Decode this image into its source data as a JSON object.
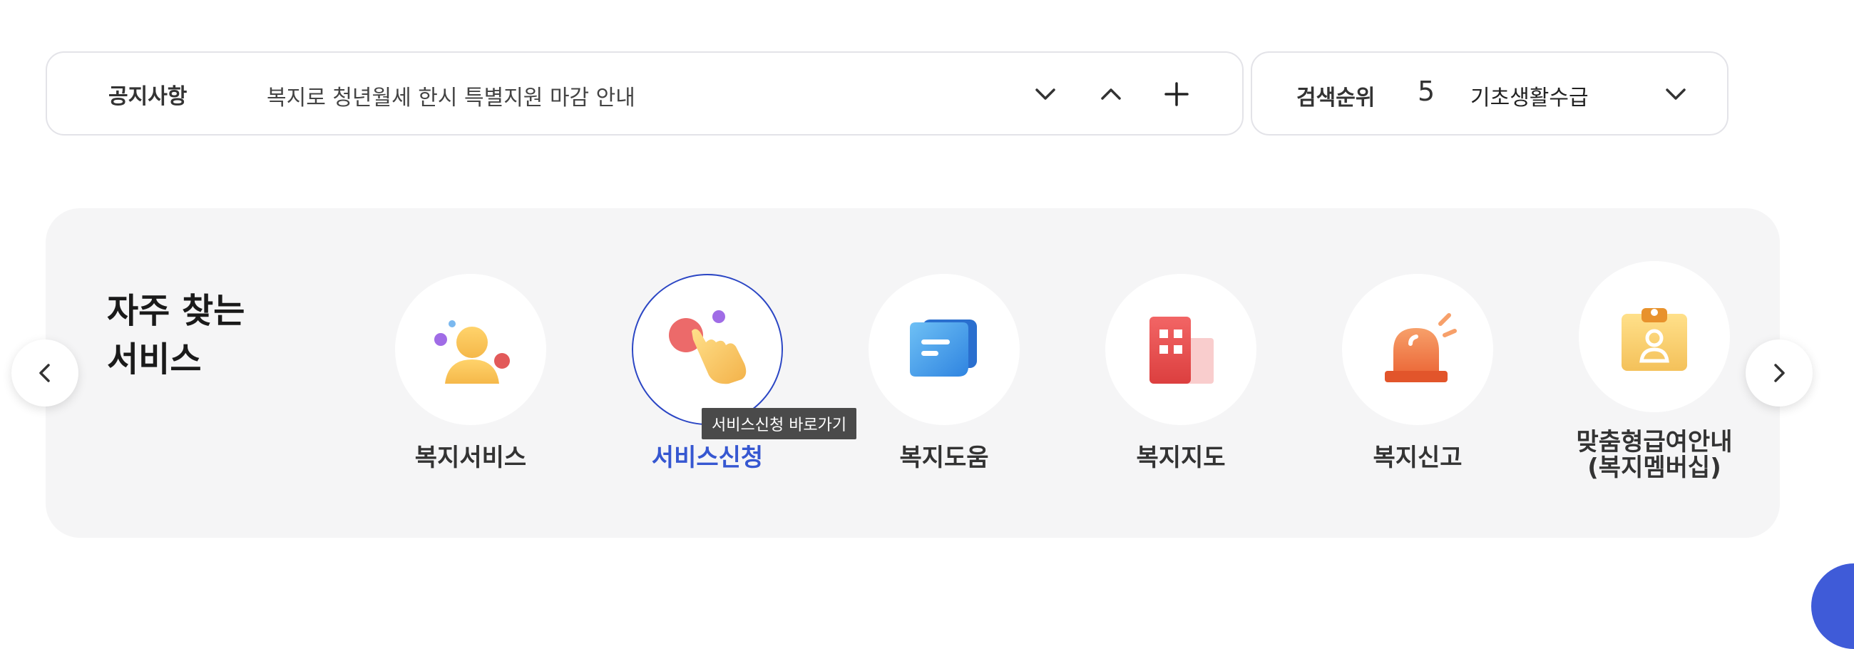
{
  "notice": {
    "label": "공지사항",
    "text": "복지로 청년월세 한시 특별지원 마감 안내",
    "next_icon": "chevron-down-icon",
    "prev_icon": "chevron-up-icon",
    "more_icon": "plus-icon"
  },
  "search_rank": {
    "label": "검색순위",
    "number": "5",
    "term": "기초생활수급",
    "toggle_icon": "chevron-down-icon"
  },
  "frequent_services": {
    "title_line1": "자주 찾는",
    "title_line2": "서비스",
    "items": [
      {
        "label": "복지서비스",
        "icon": "person-icon"
      },
      {
        "label": "서비스신청",
        "icon": "tap-hand-icon",
        "active": true
      },
      {
        "label": "복지도움",
        "icon": "chat-bubble-icon"
      },
      {
        "label": "복지지도",
        "icon": "building-icon"
      },
      {
        "label": "복지신고",
        "icon": "alarm-siren-icon"
      },
      {
        "label_line1": "맞춤형급여안내",
        "label_line2": "(복지멤버십)",
        "icon": "id-badge-icon"
      }
    ],
    "tooltip": "서비스신청 바로가기",
    "prev_icon": "chevron-left-icon",
    "next_icon": "chevron-right-icon"
  },
  "colors": {
    "accent": "#3657d1",
    "panel_bg": "#f5f5f6",
    "border": "#e3e3e8"
  }
}
